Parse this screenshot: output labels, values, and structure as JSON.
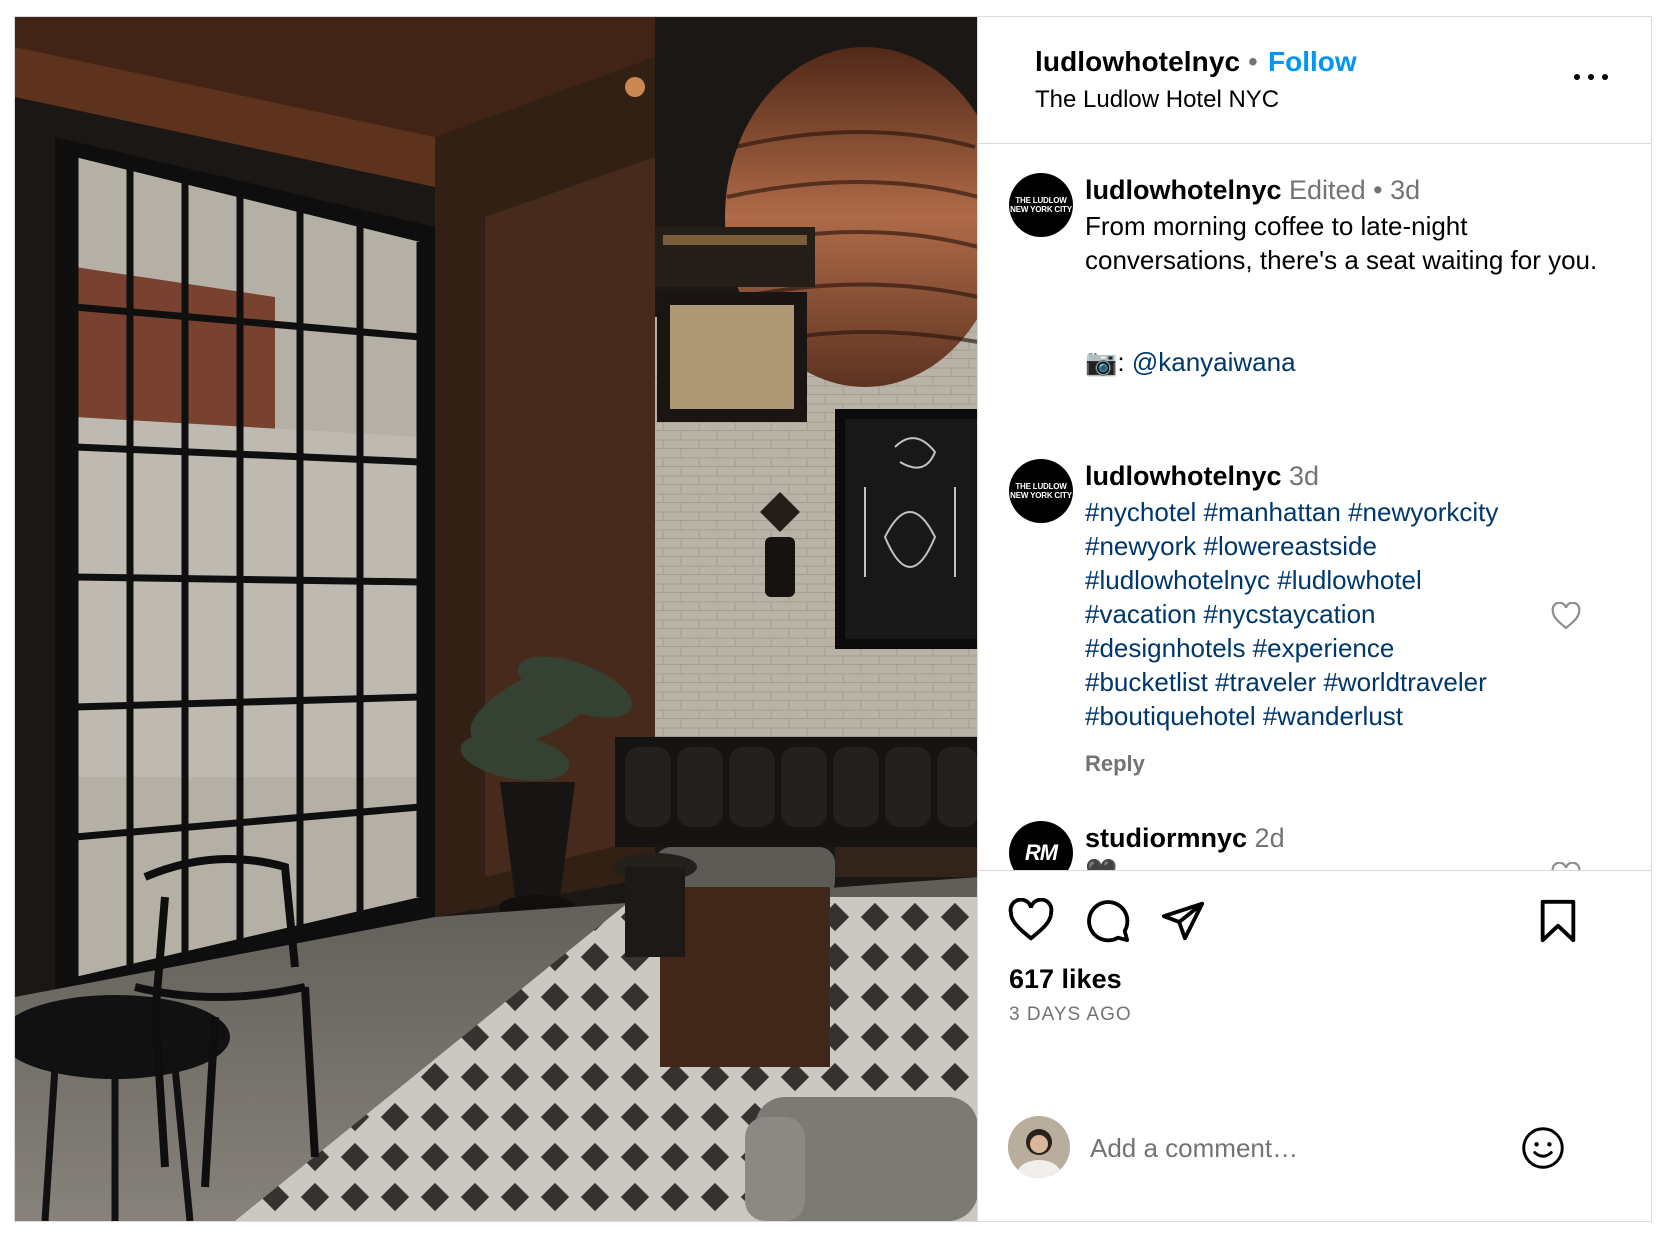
{
  "header": {
    "username": "ludlowhotelnyc",
    "separator": "•",
    "follow_label": "Follow",
    "location": "The Ludlow Hotel NYC"
  },
  "comments": [
    {
      "avatar_text": "THE LUDLOW NEW YORK CITY",
      "username": "ludlowhotelnyc",
      "edited": "Edited",
      "separator": "•",
      "time": "3d",
      "caption": "From morning coffee to late-night conversations, there's a seat waiting for you.",
      "credit_icon": "📷",
      "credit_sep": ":",
      "credit_handle": "@kanyaiwana"
    },
    {
      "avatar_text": "THE LUDLOW NEW YORK CITY",
      "username": "ludlowhotelnyc",
      "time": "3d",
      "hashtag_lines": [
        "#nychotel #manhattan #newyorkcity",
        "#newyork #lowereastside",
        "#ludlowhotelnyc #ludlowhotel",
        "#vacation #nycstaycation",
        "#designhotels #experience",
        "#bucketlist #traveler #worldtraveler",
        "#boutiquehotel #wanderlust"
      ],
      "reply_label": "Reply"
    },
    {
      "avatar_text": "RM",
      "username": "studiormnyc",
      "time": "2d",
      "text": "🖤"
    }
  ],
  "actions": {
    "icons": [
      "heart-icon",
      "comment-icon",
      "share-icon",
      "bookmark-icon"
    ],
    "likes": "617 likes",
    "time_ago": "3 DAYS AGO",
    "comment_placeholder": "Add a comment…",
    "emoji_icon": "smiley-icon"
  },
  "colors": {
    "link": "#00376b",
    "follow": "#0095f6",
    "muted": "#737373",
    "border": "#dbdbdb"
  }
}
